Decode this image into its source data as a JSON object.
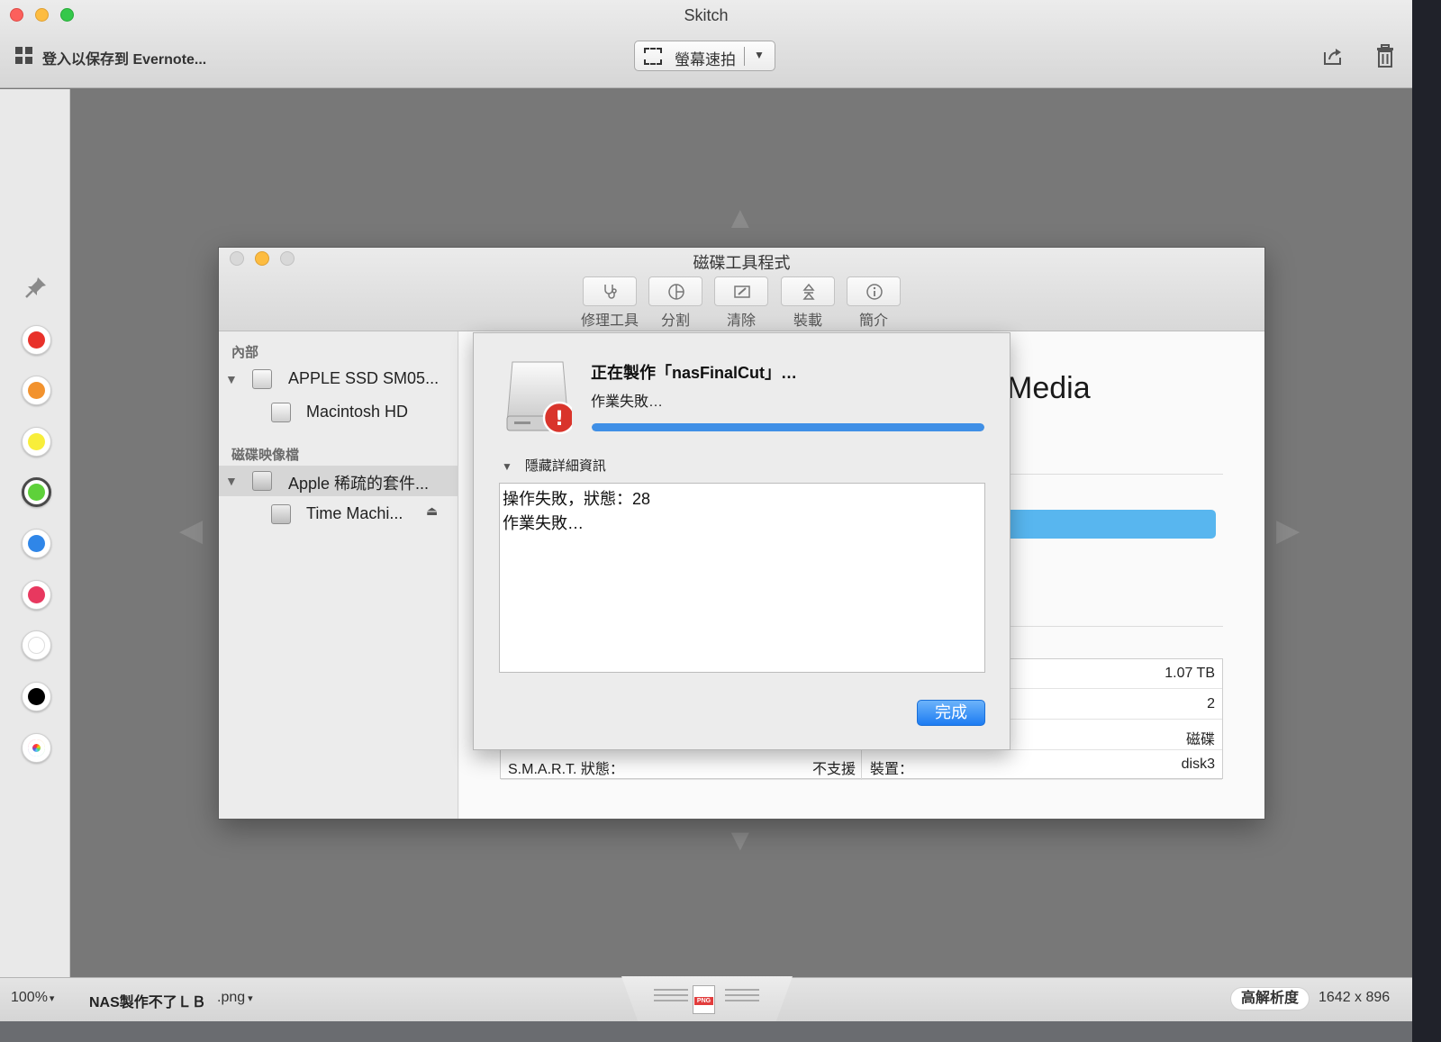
{
  "app": {
    "title": "Skitch",
    "login_label": "登入以保存到 Evernote...",
    "snapshot_label": "螢幕速拍",
    "snapshot_caret": "▼"
  },
  "palette": {
    "colors": [
      {
        "name": "red",
        "hex": "#e8312a"
      },
      {
        "name": "orange",
        "hex": "#f2922e"
      },
      {
        "name": "yellow",
        "hex": "#f8ee3a"
      },
      {
        "name": "green",
        "hex": "#5ed13a",
        "selected": true
      },
      {
        "name": "blue",
        "hex": "#2f86e8"
      },
      {
        "name": "pink",
        "hex": "#e8385f"
      },
      {
        "name": "white",
        "hex": "#ffffff"
      },
      {
        "name": "black",
        "hex": "#000000"
      },
      {
        "name": "custom-wheel",
        "hex": "conic"
      }
    ]
  },
  "disk_utility": {
    "title": "磁碟工具程式",
    "toolbar": [
      {
        "label": "修理工具",
        "icon": "stethoscope-icon"
      },
      {
        "label": "分割",
        "icon": "partition-icon"
      },
      {
        "label": "清除",
        "icon": "erase-icon"
      },
      {
        "label": "裝載",
        "icon": "mount-icon"
      },
      {
        "label": "簡介",
        "icon": "info-icon"
      }
    ],
    "sidebar": {
      "internal_header": "內部",
      "internal_items": [
        {
          "label": "APPLE SSD SM05..."
        },
        {
          "label": "Macintosh HD"
        }
      ],
      "images_header": "磁碟映像檔",
      "image_items": [
        {
          "label": "Apple 稀疏的套件..."
        },
        {
          "label": "Time Machi..."
        }
      ],
      "eject_glyph": "⏏"
    },
    "main": {
      "title_fragment": "Media",
      "info": {
        "capacity": "1.07 TB",
        "child_count": "2",
        "type": "磁碟",
        "smart_label": "S.M.A.R.T. 狀態：",
        "smart_value": "不支援",
        "device_label": "裝置：",
        "device_value": "disk3"
      }
    },
    "sheet": {
      "title": "正在製作「nasFinalCut」…",
      "subtitle": "作業失敗…",
      "progress": 1.0,
      "details_toggle": "隱藏詳細資訊",
      "details_triangle": "▼",
      "log_lines": [
        "操作失敗，狀態：28",
        "作業失敗…"
      ],
      "done_label": "完成",
      "alert_glyph": "!"
    }
  },
  "status": {
    "zoom": "100%",
    "zoom_caret": "▾",
    "filename": "NAS製作不了ＬＢ",
    "extension": ".png",
    "extension_caret": "▾",
    "format_badge": "PNG",
    "hires_label": "高解析度",
    "dimensions": "1642 x 896"
  }
}
